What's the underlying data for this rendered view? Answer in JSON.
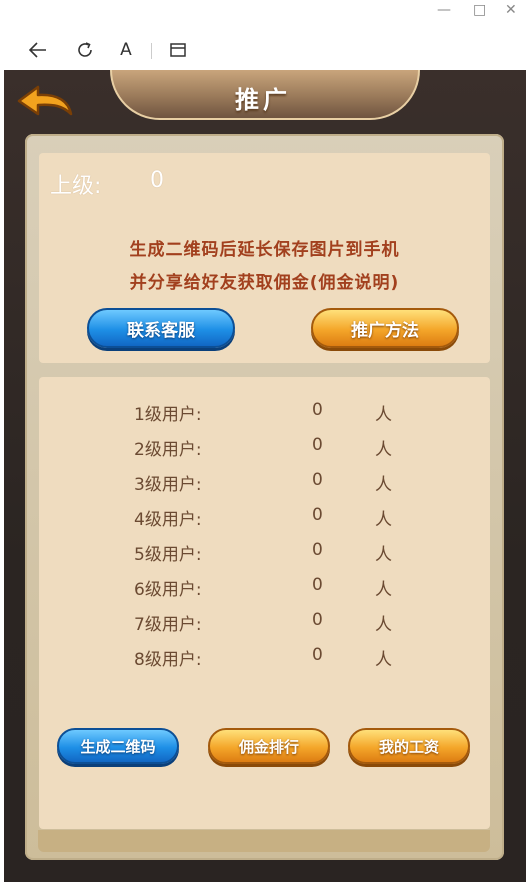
{
  "browser": {
    "minimize_glyph": "—",
    "maximize_glyph": "□",
    "close_glyph": "✕",
    "reader_glyph": "A"
  },
  "header": {
    "title": "推广"
  },
  "superior": {
    "label": "上级:",
    "value": "0"
  },
  "description": {
    "line1": "生成二维码后延长保存图片到手机",
    "line2": "并分享给好友获取佣金(佣金说明)"
  },
  "buttons": {
    "contact_service": "联系客服",
    "promo_method": "推广方法",
    "generate_qr": "生成二维码",
    "commission_rank": "佣金排行",
    "my_salary": "我的工资"
  },
  "levels": [
    {
      "label": "1级用户:",
      "count": "0",
      "unit": "人"
    },
    {
      "label": "2级用户:",
      "count": "0",
      "unit": "人"
    },
    {
      "label": "3级用户:",
      "count": "0",
      "unit": "人"
    },
    {
      "label": "4级用户:",
      "count": "0",
      "unit": "人"
    },
    {
      "label": "5级用户:",
      "count": "0",
      "unit": "人"
    },
    {
      "label": "6级用户:",
      "count": "0",
      "unit": "人"
    },
    {
      "label": "7级用户:",
      "count": "0",
      "unit": "人"
    },
    {
      "label": "8级用户:",
      "count": "0",
      "unit": "人"
    }
  ],
  "colors": {
    "accent_text": "#a2401e",
    "blue_button": "#1e8fe6",
    "orange_button": "#f4a62a",
    "panel": "#efdcbf"
  }
}
